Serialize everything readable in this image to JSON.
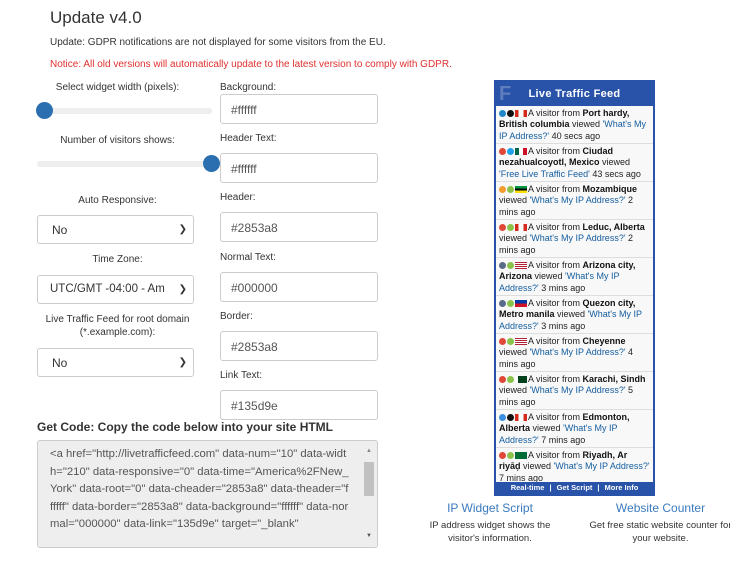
{
  "header": {
    "title": "Update v4.0",
    "update_text": "Update: GDPR notifications are not displayed for some visitors from the EU.",
    "notice_text": "Notice: All old versions will automatically update to the latest version to comply with GDPR."
  },
  "settings": {
    "width_label": "Select widget width (pixels):",
    "width_slider_value": 0,
    "visitors_label": "Number of visitors shows:",
    "visitors_slider_value": 1,
    "auto_responsive_label": "Auto Responsive:",
    "auto_responsive_value": "No",
    "timezone_label": "Time Zone:",
    "timezone_value": "UTC/GMT -04:00 - Am",
    "root_label": "Live Traffic Feed for root domain (*.example.com):",
    "root_value": "No",
    "background_label": "Background:",
    "background_value": "#ffffff",
    "header_text_label": "Header Text:",
    "header_text_value": "#ffffff",
    "header_label": "Header:",
    "header_value": "#2853a8",
    "normal_text_label": "Normal Text:",
    "normal_text_value": "#000000",
    "border_label": "Border:",
    "border_value": "#2853a8",
    "link_text_label": "Link Text:",
    "link_text_value": "#135d9e"
  },
  "code": {
    "heading": "Get Code: Copy the code below into your site HTML",
    "text": "<a href=\"http://livetrafficfeed.com\" data-num=\"10\" data-width=\"210\" data-responsive=\"0\" data-time=\"America%2FNew_York\" data-root=\"0\" data-cheader=\"2853a8\" data-theader=\"ffffff\" data-border=\"2853a8\" data-background=\"ffffff\" data-normal=\"000000\" data-link=\"135d9e\" target=\"_blank\""
  },
  "widget": {
    "title": "Live Traffic Feed",
    "colors": {
      "header": "#2853a8",
      "link": "#135d9e"
    },
    "items": [
      {
        "browser": "edge",
        "os": "apple",
        "flag": "canada",
        "prefix": "A visitor from ",
        "location": "Port hardy, British columbia",
        "mid": " viewed ",
        "link": "'What's My IP Address?'",
        "time": " 40 secs ago"
      },
      {
        "browser": "chrome",
        "os": "windows",
        "flag": "mexico",
        "prefix": "A visitor from ",
        "location": "Ciudad nezahualcoyotl, Mexico",
        "mid": " viewed ",
        "link": "'Free Live Traffic Feed'",
        "time": " 43 secs ago"
      },
      {
        "browser": "other",
        "os": "android",
        "flag": "mozambique",
        "prefix": "A visitor from ",
        "location": "Mozambique",
        "mid": " viewed ",
        "link": "'What's My IP Address?'",
        "time": " 2 mins ago"
      },
      {
        "browser": "chrome",
        "os": "android",
        "flag": "canada",
        "prefix": "A visitor from ",
        "location": "Leduc, Alberta",
        "mid": " viewed ",
        "link": "'What's My IP Address?'",
        "time": " 2 mins ago"
      },
      {
        "browser": "gear",
        "os": "android",
        "flag": "usa",
        "prefix": "A visitor from ",
        "location": "Arizona city, Arizona",
        "mid": " viewed ",
        "link": "'What's My IP Address?'",
        "time": " 3 mins ago"
      },
      {
        "browser": "gear",
        "os": "android",
        "flag": "philippines",
        "prefix": "A visitor from ",
        "location": "Quezon city, Metro manila",
        "mid": " viewed ",
        "link": "'What's My IP Address?'",
        "time": " 3 mins ago"
      },
      {
        "browser": "chrome",
        "os": "android",
        "flag": "usa",
        "prefix": "A visitor from ",
        "location": "Cheyenne",
        "mid": " viewed ",
        "link": "'What's My IP Address?'",
        "time": " 4 mins ago"
      },
      {
        "browser": "chrome",
        "os": "android",
        "flag": "pakistan",
        "prefix": "A visitor from ",
        "location": "Karachi, Sindh",
        "mid": " viewed ",
        "link": "'What's My IP Address?'",
        "time": " 5 mins ago"
      },
      {
        "browser": "safari",
        "os": "apple",
        "flag": "canada",
        "prefix": "A visitor from ",
        "location": "Edmonton, Alberta",
        "mid": " viewed ",
        "link": "'What's My IP Address?'",
        "time": " 7 mins ago"
      },
      {
        "browser": "chrome",
        "os": "android",
        "flag": "saudi-arabia",
        "prefix": "A visitor from ",
        "location": "Riyadh, Ar riyāḑ",
        "mid": " viewed ",
        "link": "'What's My IP Address?'",
        "time": " 7 mins ago"
      }
    ],
    "footer": [
      "Real-time",
      "Get Script",
      "More Info"
    ]
  },
  "promos": [
    {
      "title": "IP Widget Script",
      "desc": "IP address widget shows the visitor's information."
    },
    {
      "title": "Website Counter",
      "desc": "Get free static website counter for your website."
    }
  ]
}
